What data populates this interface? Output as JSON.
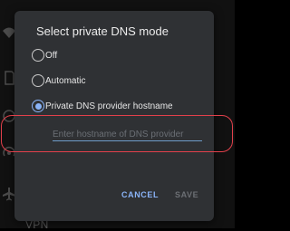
{
  "dialog": {
    "title": "Select private DNS mode",
    "options": [
      {
        "label": "Off",
        "checked": false
      },
      {
        "label": "Automatic",
        "checked": false
      },
      {
        "label": "Private DNS provider hostname",
        "checked": true
      }
    ],
    "hostname_input": {
      "value": "",
      "placeholder": "Enter hostname of DNS provider"
    },
    "buttons": {
      "cancel": "CANCEL",
      "save": "SAVE"
    }
  },
  "background": {
    "label": "VPN",
    "icons": [
      "wifi-icon",
      "sim-card-icon",
      "data-usage-icon",
      "hotspot-icon",
      "airplane-icon"
    ]
  },
  "colors": {
    "accent": "#8ab4f8",
    "dialog_bg": "#2f3134",
    "highlight": "#e2404b",
    "disabled": "#6c6f74"
  }
}
